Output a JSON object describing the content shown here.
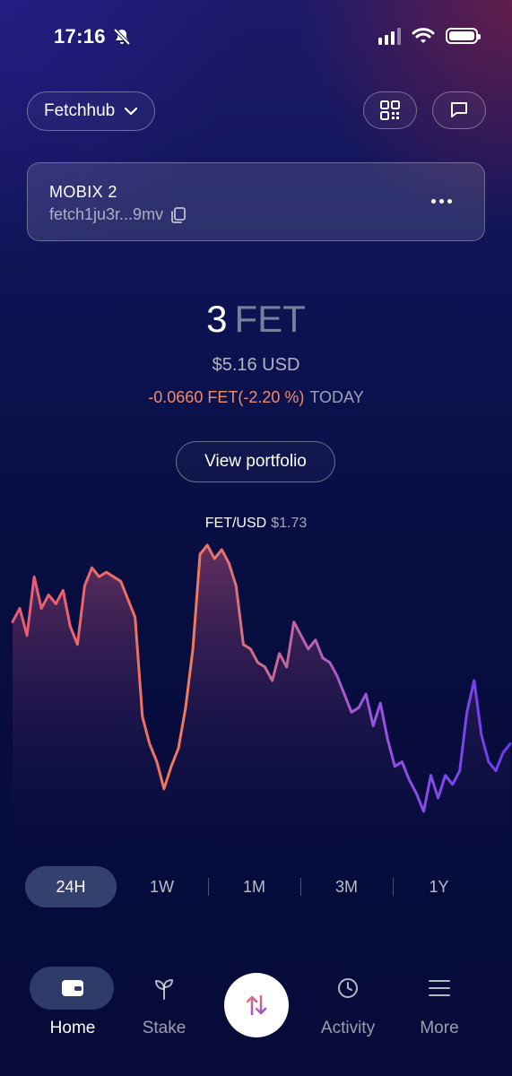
{
  "status_bar": {
    "time": "17:16"
  },
  "header": {
    "network": "Fetchhub"
  },
  "account": {
    "name": "MOBIX 2",
    "address": "fetch1ju3r...9mv"
  },
  "balance": {
    "amount": "3",
    "denom": "FET",
    "usd": "$5.16 USD",
    "change": "-0.0660 FET(-2.20 %)",
    "change_period": "TODAY"
  },
  "view_portfolio_label": "View portfolio",
  "price": {
    "pair": "FET/USD",
    "value": "$1.73"
  },
  "chart_data": {
    "type": "area",
    "values": [
      63,
      66,
      60,
      73,
      66,
      69,
      67,
      70,
      62,
      58,
      71,
      75,
      73,
      74,
      73,
      72,
      68,
      64,
      42,
      36,
      32,
      26,
      31,
      35,
      44,
      57,
      78,
      80,
      77,
      79,
      76,
      71,
      58,
      57,
      54,
      53,
      50,
      56,
      53,
      63,
      60,
      57,
      59,
      55,
      54,
      51,
      47,
      43,
      44,
      47,
      40,
      45,
      37,
      31,
      32,
      28,
      25,
      21,
      29,
      24,
      29,
      27,
      30,
      43,
      50,
      38,
      32,
      30,
      34,
      36
    ],
    "colors": [
      "#e85a76",
      "#f07a5a",
      "#9b54e0",
      "#6a3df0"
    ]
  },
  "ranges": {
    "r24h": "24H",
    "r1w": "1W",
    "r1m": "1M",
    "r3m": "3M",
    "r1y": "1Y",
    "active": "24H"
  },
  "nav": {
    "home": "Home",
    "stake": "Stake",
    "activity": "Activity",
    "more": "More"
  }
}
